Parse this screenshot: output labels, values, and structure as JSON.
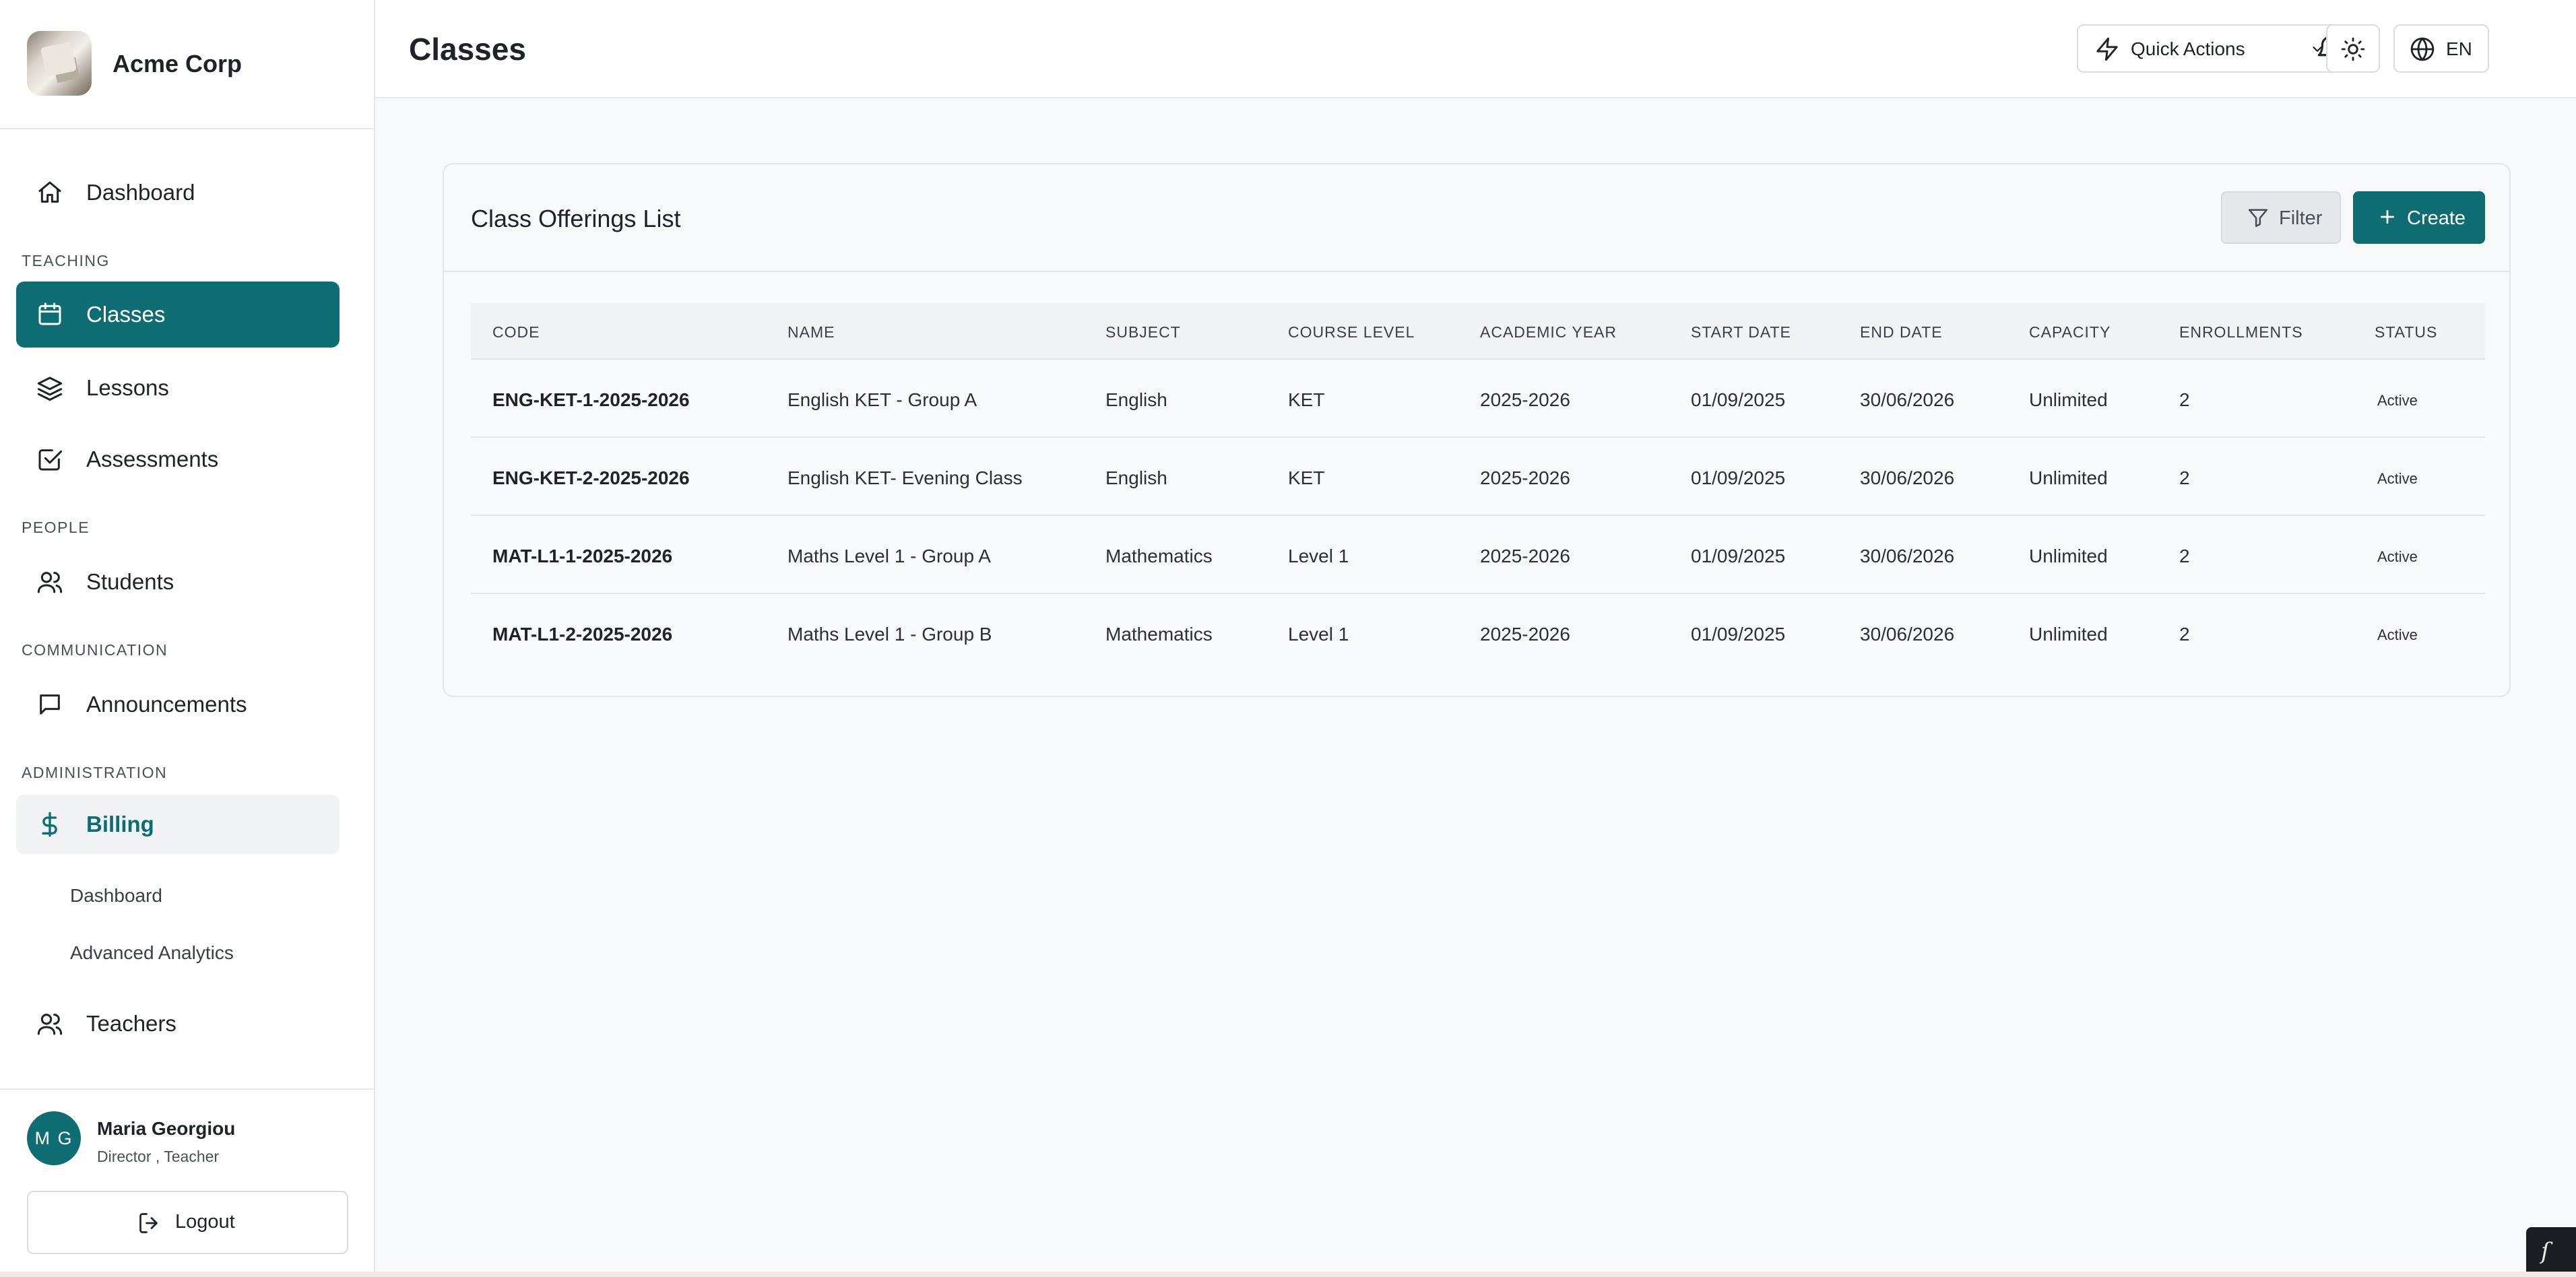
{
  "app": {
    "brand": "Acme Corp"
  },
  "sidebar": {
    "dashboard": "Dashboard",
    "sections": {
      "teaching": "TEACHING",
      "people": "PEOPLE",
      "communication": "COMMUNICATION",
      "administration": "ADMINISTRATION"
    },
    "classes": "Classes",
    "lessons": "Lessons",
    "assessments": "Assessments",
    "students": "Students",
    "announcements": "Announcements",
    "billing": "Billing",
    "billing_sub": [
      "Dashboard",
      "Advanced Analytics"
    ],
    "teachers": "Teachers"
  },
  "user": {
    "initials": "M G",
    "name": "Maria Georgiou",
    "role": "Director , Teacher"
  },
  "logout_label": "Logout",
  "header": {
    "title": "Classes",
    "quick_actions": "Quick Actions",
    "language": "EN"
  },
  "card": {
    "title": "Class Offerings List",
    "filter_label": "Filter",
    "create_label": "Create"
  },
  "table": {
    "columns": [
      "CODE",
      "NAME",
      "SUBJECT",
      "COURSE LEVEL",
      "ACADEMIC YEAR",
      "START DATE",
      "END DATE",
      "CAPACITY",
      "ENROLLMENTS",
      "STATUS"
    ],
    "rows": [
      [
        "ENG-KET-1-2025-2026",
        "English KET - Group A",
        "English",
        "KET",
        "2025-2026",
        "01/09/2025",
        "30/06/2026",
        "Unlimited",
        "2",
        "Active"
      ],
      [
        "ENG-KET-2-2025-2026",
        "English KET- Evening Class",
        "English",
        "KET",
        "2025-2026",
        "01/09/2025",
        "30/06/2026",
        "Unlimited",
        "2",
        "Active"
      ],
      [
        "MAT-L1-1-2025-2026",
        "Maths Level 1 - Group A",
        "Mathematics",
        "Level 1",
        "2025-2026",
        "01/09/2025",
        "30/06/2026",
        "Unlimited",
        "2",
        "Active"
      ],
      [
        "MAT-L1-2-2025-2026",
        "Maths Level 1 - Group B",
        "Mathematics",
        "Level 1",
        "2025-2026",
        "01/09/2025",
        "30/06/2026",
        "Unlimited",
        "2",
        "Active"
      ]
    ]
  },
  "colors": {
    "accent": "#0e6d73",
    "background": "#f8f9fb",
    "border": "#e3e6ea"
  },
  "icons": [
    "home-icon",
    "calendar-icon",
    "layers-icon",
    "checkbox-icon",
    "users-icon",
    "message-icon",
    "dollar-icon",
    "logout-icon",
    "zap-icon",
    "chevron-down-icon",
    "bell-icon",
    "sun-icon",
    "globe-icon",
    "filter-icon",
    "plus-icon"
  ]
}
